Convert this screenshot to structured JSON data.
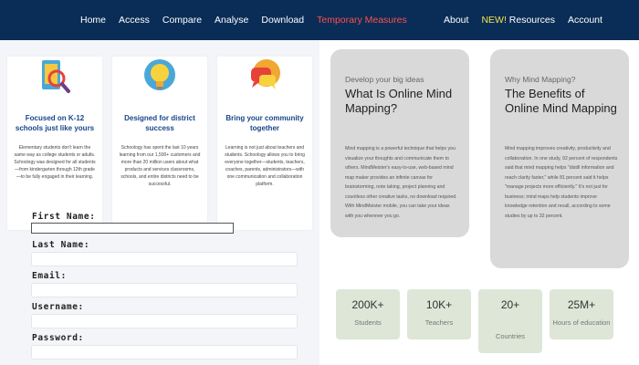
{
  "nav": {
    "left": [
      "Home",
      "Access",
      "Compare",
      "Analyse",
      "Download",
      "Temporary Measures"
    ],
    "right": {
      "about": "About",
      "new_badge": "NEW!",
      "resources": "Resources",
      "account": "Account"
    }
  },
  "cards": [
    {
      "title": "Focused on K-12 schools just like yours",
      "text": "Elementary students don't learn the same way as college students or adults. Schoology was designed for all students—from kindergarten through 12th grade—to be fully engaged in their learning.",
      "icon": "magnifier-on-device-icon"
    },
    {
      "title": "Designed for district success",
      "text": "Schoology has spent the last 10 years learning from our 1,500+ customers and more than 20 million users about what products and services classrooms, schools, and entire districts need to be successful.",
      "icon": "lightbulb-icon"
    },
    {
      "title": "Bring your community together",
      "text": "Learning is not just about teachers and students. Schoology allows you to bring everyone together—students, teachers, coaches, parents, administrators—with one communication and collaboration platform.",
      "icon": "chat-bubbles-icon"
    }
  ],
  "form": {
    "first_name": "First Name:",
    "last_name": "Last Name:",
    "email": "Email:",
    "username": "Username:",
    "password": "Password:"
  },
  "info": [
    {
      "eyebrow": "Develop your big ideas",
      "title": "What Is Online Mind Mapping?",
      "text": "Mind mapping is a powerful technique that helps you visualize your thoughts and communicate them to others. MindMeister's easy-to-use, web-based mind map maker provides an infinite canvas for brainstorming, note taking, project planning and countless other creative tasks, no download required. With MindMeister mobile, you can take your ideas with you wherever you go."
    },
    {
      "eyebrow": "Why Mind Mapping?",
      "title": "The Benefits of Online Mind Mapping",
      "text": "Mind mapping improves creativity, productivity and collaboration. In one study, 92 percent of respondents said that mind mapping helps \"distill information and reach clarity faster,\" while 81 percent said it helps \"manage projects more efficiently.\" It's not just for business; mind maps help students improve knowledge retention and recall, according to some studies by up to 32 percent."
    }
  ],
  "stats": [
    {
      "num": "200K+",
      "label": "Students"
    },
    {
      "num": "10K+",
      "label": "Teachers"
    },
    {
      "num": "20+",
      "label": "Countries"
    },
    {
      "num": "25M+",
      "label": "Hours of education"
    }
  ]
}
